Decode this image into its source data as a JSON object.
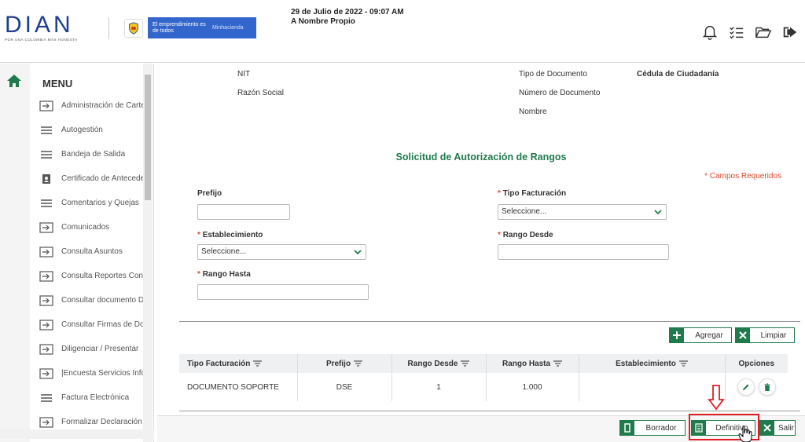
{
  "header": {
    "logo_text": "DIAN",
    "logo_tagline": "POR UNA COLOMBIA MÁS HONESTA",
    "gov_banner_left": "El emprendimiento es de todos",
    "gov_banner_right": "Minhacienda",
    "date": "29 de Julio de 2022 - 09:07 AM",
    "user_mode": "A Nombre Propio",
    "icons": [
      "bell-icon",
      "checklist-icon",
      "folder-open-icon",
      "logout-icon"
    ]
  },
  "sidebar": {
    "title": "MENU",
    "items": [
      {
        "label": "Administración de Carter",
        "icon": "enter-icon"
      },
      {
        "label": "Autogestión",
        "icon": "menu-lines-icon"
      },
      {
        "label": "Bandeja de Salida",
        "icon": "menu-lines-icon"
      },
      {
        "label": "Certificado de Anteceder",
        "icon": "clipboard-user-icon"
      },
      {
        "label": "Comentarios y Quejas",
        "icon": "menu-lines-icon"
      },
      {
        "label": "Comunicados",
        "icon": "enter-icon"
      },
      {
        "label": "Consulta Asuntos",
        "icon": "enter-icon"
      },
      {
        "label": "Consulta Reportes Conc",
        "icon": "enter-icon"
      },
      {
        "label": "Consultar documento Dil",
        "icon": "enter-icon"
      },
      {
        "label": "Consultar Firmas de Doc",
        "icon": "enter-icon"
      },
      {
        "label": "Diligenciar / Presentar",
        "icon": "enter-icon"
      },
      {
        "label": "|Encuesta Servicios Infor",
        "icon": "enter-icon"
      },
      {
        "label": "Factura Electrónica",
        "icon": "menu-lines-icon"
      },
      {
        "label": "Formalizar Declaración I",
        "icon": "enter-icon"
      }
    ]
  },
  "info": {
    "nit_label": "NIT",
    "razon_label": "Razón Social",
    "tipo_doc_label": "Tipo de Documento",
    "tipo_doc_value": "Cédula de Ciudadanía",
    "num_doc_label": "Número de Documento",
    "nombre_label": "Nombre"
  },
  "form": {
    "title": "Solicitud de Autorización de Rangos",
    "required_note": "* Campos Requeridos",
    "prefijo_label": "Prefijo",
    "prefijo_value": "",
    "tipo_facturacion_label": "Tipo Facturación",
    "tipo_facturacion_value": "Seleccione...",
    "establecimiento_label": "Establecimiento",
    "establecimiento_value": "Seleccione...",
    "rango_desde_label": "Rango Desde",
    "rango_desde_value": "",
    "rango_hasta_label": "Rango Hasta",
    "rango_hasta_value": "",
    "required_mark": "*"
  },
  "actions": {
    "agregar": "Agregar",
    "limpiar": "Limpiar"
  },
  "table": {
    "headers": [
      "Tipo Facturación",
      "Prefijo",
      "Rango Desde",
      "Rango Hasta",
      "Establecimiento",
      "Opciones"
    ],
    "rows": [
      {
        "tipo": "DOCUMENTO SOPORTE",
        "prefijo": "DSE",
        "desde": "1",
        "hasta": "1.000",
        "establecimiento": ""
      }
    ]
  },
  "footer": {
    "borrador": "Borrador",
    "definitivo": "Definitivo",
    "salir": "Salir"
  },
  "colors": {
    "brand_green": "#1f7a4c",
    "required_red": "#e04a2c",
    "highlight_red": "#e21f26",
    "gov_blue": "#3366cc"
  }
}
